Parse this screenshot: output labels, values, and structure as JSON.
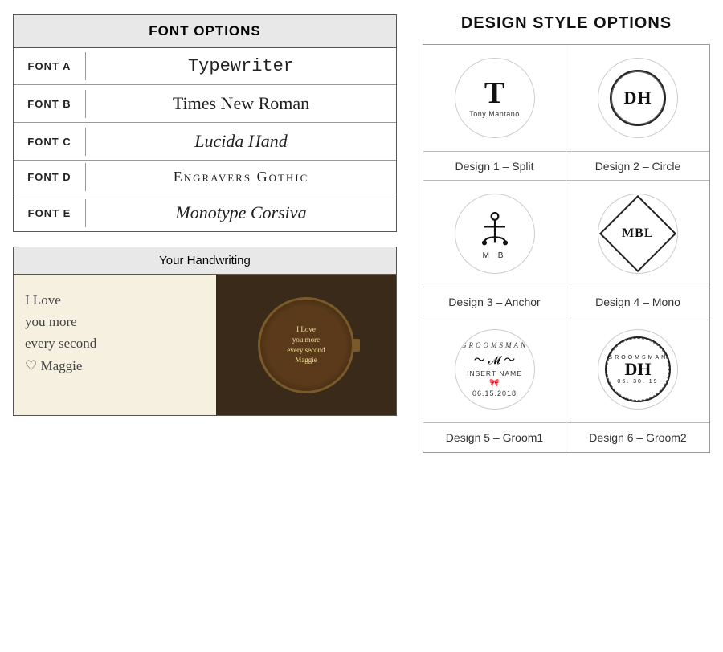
{
  "left": {
    "font_section_title": "FONT OPTIONS",
    "fonts": [
      {
        "label": "FONT A",
        "sample": "Typewriter",
        "class": "font-a"
      },
      {
        "label": "FONT B",
        "sample": "Times New Roman",
        "class": "font-b"
      },
      {
        "label": "FONT C",
        "sample": "Lucida Hand",
        "class": "font-c"
      },
      {
        "label": "FONT D",
        "sample": "Engravers Gothic",
        "class": "font-d"
      },
      {
        "label": "FONT E",
        "sample": "Monotype Corsiva",
        "class": "font-e"
      }
    ],
    "handwriting_title": "Your Handwriting",
    "handwriting_text": "I Love\nyou more\nevery second\n♡ Maggie",
    "watch_text": "I Love\nyou more\nevery second\nMaggie"
  },
  "right": {
    "section_title": "DESIGN STYLE OPTIONS",
    "designs": [
      {
        "id": 1,
        "label": "Design 1 – Split"
      },
      {
        "id": 2,
        "label": "Design 2 – Circle"
      },
      {
        "id": 3,
        "label": "Design 3 – Anchor"
      },
      {
        "id": 4,
        "label": "Design 4 – Mono"
      },
      {
        "id": 5,
        "label": "Design 5 – Groom1"
      },
      {
        "id": 6,
        "label": "Design 6 – Groom2"
      }
    ],
    "design1": {
      "letter": "T",
      "name": "Tony Mantano"
    },
    "design2": {
      "letters": "DH"
    },
    "design3": {
      "initials": "M   B"
    },
    "design4": {
      "letters": "MBL"
    },
    "design5": {
      "top": "GROOMSMAN",
      "insert": "INSERT NAME",
      "date": "06.15.2018"
    },
    "design6": {
      "top": "GROOMSMAN",
      "letters": "DH",
      "date": "06. 30. 19"
    }
  }
}
